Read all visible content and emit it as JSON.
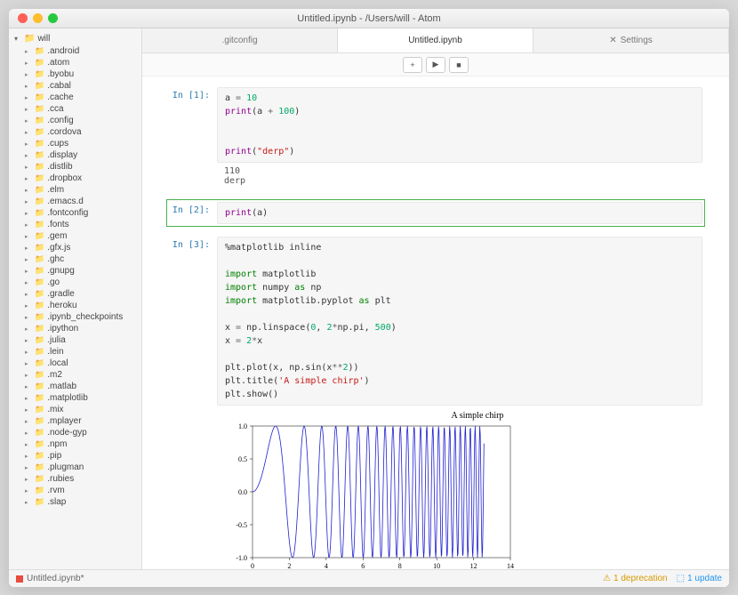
{
  "window": {
    "title": "Untitled.ipynb - /Users/will - Atom"
  },
  "sidebar": {
    "root": "will",
    "items": [
      ".android",
      ".atom",
      ".byobu",
      ".cabal",
      ".cache",
      ".cca",
      ".config",
      ".cordova",
      ".cups",
      ".display",
      ".distlib",
      ".dropbox",
      ".elm",
      ".emacs.d",
      ".fontconfig",
      ".fonts",
      ".gem",
      ".gfx.js",
      ".ghc",
      ".gnupg",
      ".go",
      ".gradle",
      ".heroku",
      ".ipynb_checkpoints",
      ".ipython",
      ".julia",
      ".lein",
      ".local",
      ".m2",
      ".matlab",
      ".matplotlib",
      ".mix",
      ".mplayer",
      ".node-gyp",
      ".npm",
      ".pip",
      ".plugman",
      ".rubies",
      ".rvm",
      ".slap"
    ]
  },
  "tabs": [
    {
      "label": ".gitconfig",
      "active": false
    },
    {
      "label": "Untitled.ipynb",
      "active": true
    },
    {
      "label": "Settings",
      "active": false,
      "icon": "gear"
    }
  ],
  "cells": [
    {
      "prompt": "In [1]:",
      "code_html": "a <span class='k-op'>=</span> <span class='k-num'>10</span>\n<span class='k-fn'>print</span>(a <span class='k-op'>+</span> <span class='k-num'>100</span>)\n\n\n<span class='k-fn'>print</span>(<span class='k-str'>\"derp\"</span>)",
      "output": "110\nderp"
    },
    {
      "prompt": "In [2]:",
      "selected": true,
      "code_html": "<span class='k-fn'>print</span>(a)"
    },
    {
      "prompt": "In [3]:",
      "code_html": "%matplotlib inline\n\n<span class='k-kw'>import</span> matplotlib\n<span class='k-kw'>import</span> numpy <span class='k-kw'>as</span> np\n<span class='k-kw'>import</span> matplotlib.pyplot <span class='k-kw'>as</span> plt\n\nx <span class='k-op'>=</span> np.linspace(<span class='k-num'>0</span>, <span class='k-num'>2</span><span class='k-op'>*</span>np.pi, <span class='k-num'>500</span>)\nx <span class='k-op'>=</span> <span class='k-num'>2</span><span class='k-op'>*</span>x\n\nplt.plot(x, np.sin(x<span class='k-op'>**</span><span class='k-num'>2</span>))\nplt.title(<span class='k-str'>'A simple chirp'</span>)\nplt.show()",
      "has_chart": true
    }
  ],
  "chart_data": {
    "type": "line",
    "title": "A simple chirp",
    "xlabel": "",
    "ylabel": "",
    "xlim": [
      0,
      14
    ],
    "ylim": [
      -1.0,
      1.0
    ],
    "xticks": [
      0,
      2,
      4,
      6,
      8,
      10,
      12,
      14
    ],
    "yticks": [
      -1.0,
      -0.5,
      0.0,
      0.5,
      1.0
    ],
    "function": "sin(x^2)",
    "x_range": [
      0,
      12.566
    ],
    "n_points": 500
  },
  "statusbar": {
    "file": "Untitled.ipynb*",
    "deprecation": "1 deprecation",
    "update": "1 update"
  }
}
